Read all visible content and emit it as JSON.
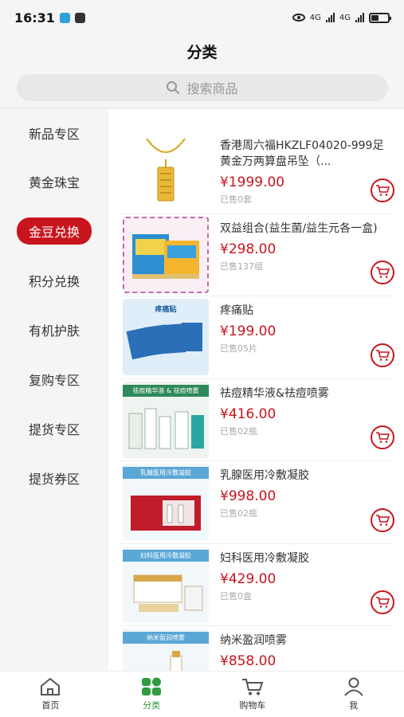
{
  "status": {
    "time": "16:31",
    "net1": "4G",
    "net2": "4G"
  },
  "title": "分类",
  "search": {
    "placeholder": "搜索商品",
    "icon": "search-icon"
  },
  "sidebar": {
    "items": [
      {
        "label": "新品专区",
        "active": false
      },
      {
        "label": "黄金珠宝",
        "active": false
      },
      {
        "label": "金豆兑换",
        "active": true
      },
      {
        "label": "积分兑换",
        "active": false
      },
      {
        "label": "有机护肤",
        "active": false
      },
      {
        "label": "复购专区",
        "active": false
      },
      {
        "label": "提货专区",
        "active": false
      },
      {
        "label": "提货券区",
        "active": false
      }
    ]
  },
  "products": [
    {
      "name": "香港周六福HKZLF04020-999足黄金万两算盘吊坠（...",
      "price": "¥1999.00",
      "sold": "已售0套",
      "img_text": ""
    },
    {
      "name": "双益组合(益生菌/益生元各一盒)",
      "price": "¥298.00",
      "sold": "已售137组",
      "img_text": ""
    },
    {
      "name": "疼痛贴",
      "price": "¥199.00",
      "sold": "已售05片",
      "img_text": "疼痛贴"
    },
    {
      "name": "祛痘精华液&祛痘喷雾",
      "price": "¥416.00",
      "sold": "已售02瓶",
      "img_text": "祛痘精华液 & 祛痘喷雾"
    },
    {
      "name": "乳腺医用冷敷凝胶",
      "price": "¥998.00",
      "sold": "已售02瓶",
      "img_text": "乳腺医用冷敷凝胶"
    },
    {
      "name": "妇科医用冷敷凝胶",
      "price": "¥429.00",
      "sold": "已售0盒",
      "img_text": "妇科医用冷敷凝胶"
    },
    {
      "name": "纳米盈润喷雾",
      "price": "¥858.00",
      "sold": "",
      "img_text": "纳米盈润喷雾"
    }
  ],
  "tabbar": [
    {
      "label": "首页",
      "icon": "home-icon",
      "active": false
    },
    {
      "label": "分类",
      "icon": "category-icon",
      "active": true
    },
    {
      "label": "购物车",
      "icon": "cart-icon",
      "active": false
    },
    {
      "label": "我",
      "icon": "user-icon",
      "active": false
    }
  ],
  "colors": {
    "accent": "#c8151d",
    "tab_active": "#2f9a3e"
  }
}
